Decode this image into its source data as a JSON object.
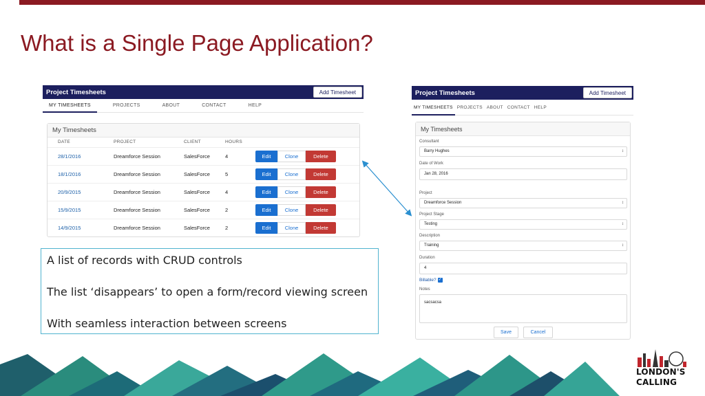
{
  "slide": {
    "title": "What is a Single Page Application?",
    "accent_color": "#8b1a22"
  },
  "list_app": {
    "title": "Project Timesheets",
    "add_button": "Add Timesheet",
    "nav": [
      "MY TIMESHEETS",
      "PROJECTS",
      "ABOUT",
      "CONTACT",
      "HELP"
    ],
    "card_title": "My Timesheets",
    "columns": [
      "DATE",
      "PROJECT",
      "CLIENT",
      "HOURS"
    ],
    "rows": [
      {
        "date": "28/1/2016",
        "project": "Dreamforce Session",
        "client": "SalesForce",
        "hours": "4"
      },
      {
        "date": "18/1/2016",
        "project": "Dreamforce Session",
        "client": "SalesForce",
        "hours": "5"
      },
      {
        "date": "20/9/2015",
        "project": "Dreamforce Session",
        "client": "SalesForce",
        "hours": "4"
      },
      {
        "date": "15/9/2015",
        "project": "Dreamforce Session",
        "client": "SalesForce",
        "hours": "2"
      },
      {
        "date": "14/9/2015",
        "project": "Dreamforce Session",
        "client": "SalesForce",
        "hours": "2"
      }
    ],
    "row_actions": {
      "edit": "Edit",
      "clone": "Clone",
      "delete": "Delete"
    }
  },
  "notes": {
    "line1": "A list of records with CRUD controls",
    "line2": "The list ‘disappears’ to open a form/record viewing screen",
    "line3": "With seamless interaction between screens"
  },
  "form_app": {
    "title": "Project Timesheets",
    "add_button": "Add Timesheet",
    "nav": [
      "MY TIMESHEETS",
      "PROJECTS",
      "ABOUT",
      "CONTACT",
      "HELP"
    ],
    "card_title": "My Timesheets",
    "consultant_label": "Consultant",
    "consultant_value": "Barry Hughes",
    "date_label": "Date of Work",
    "date_value": "Jan 28, 2016",
    "project_label": "Project",
    "project_value": "Dreamforce Session",
    "stage_label": "Project Stage",
    "stage_value": "Testing",
    "description_label": "Description",
    "description_value": "Training",
    "duration_label": "Duration",
    "duration_value": "4",
    "billable_label": "Billable?",
    "notes_label": "Notes",
    "notes_value": "sacsacsa",
    "save_button": "Save",
    "cancel_button": "Cancel"
  },
  "logo": {
    "line1": "LONDON'S",
    "line2": "CALLING"
  }
}
